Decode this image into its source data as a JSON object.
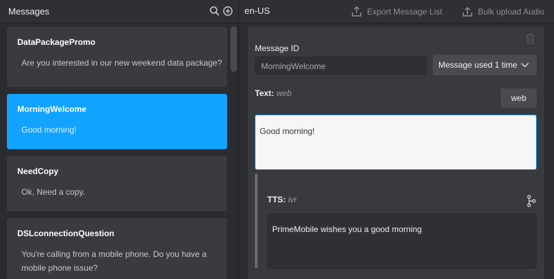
{
  "header": {
    "title": "Messages",
    "locale": "en-US",
    "export_label": "Export Message List",
    "bulk_upload_label": "Bulk upload Audio"
  },
  "messages": [
    {
      "id": "DataPackagePromo",
      "text": "Are you interested in our new weekend data package?"
    },
    {
      "id": "MorningWelcome",
      "text": "Good morning!"
    },
    {
      "id": "NeedCopy",
      "text": "Ok, Need a copy."
    },
    {
      "id": "DSLconnectionQuestion",
      "text": "You're calling from a mobile phone. Do you have a mobile phone issue?"
    }
  ],
  "editor": {
    "message_id_label": "Message ID",
    "message_id_value": "MorningWelcome",
    "usage_label": "Message used 1 time",
    "text_label": "Text:",
    "text_channel": "web",
    "web_button_label": "web",
    "text_value": "Good morning!",
    "tts_label": "TTS:",
    "tts_channel": "ivr",
    "tts_value": "PrimeMobile wishes you a good morning"
  },
  "colors": {
    "accent": "#12a2ff",
    "background": "#2b2c2f",
    "panel": "#393a3e"
  }
}
